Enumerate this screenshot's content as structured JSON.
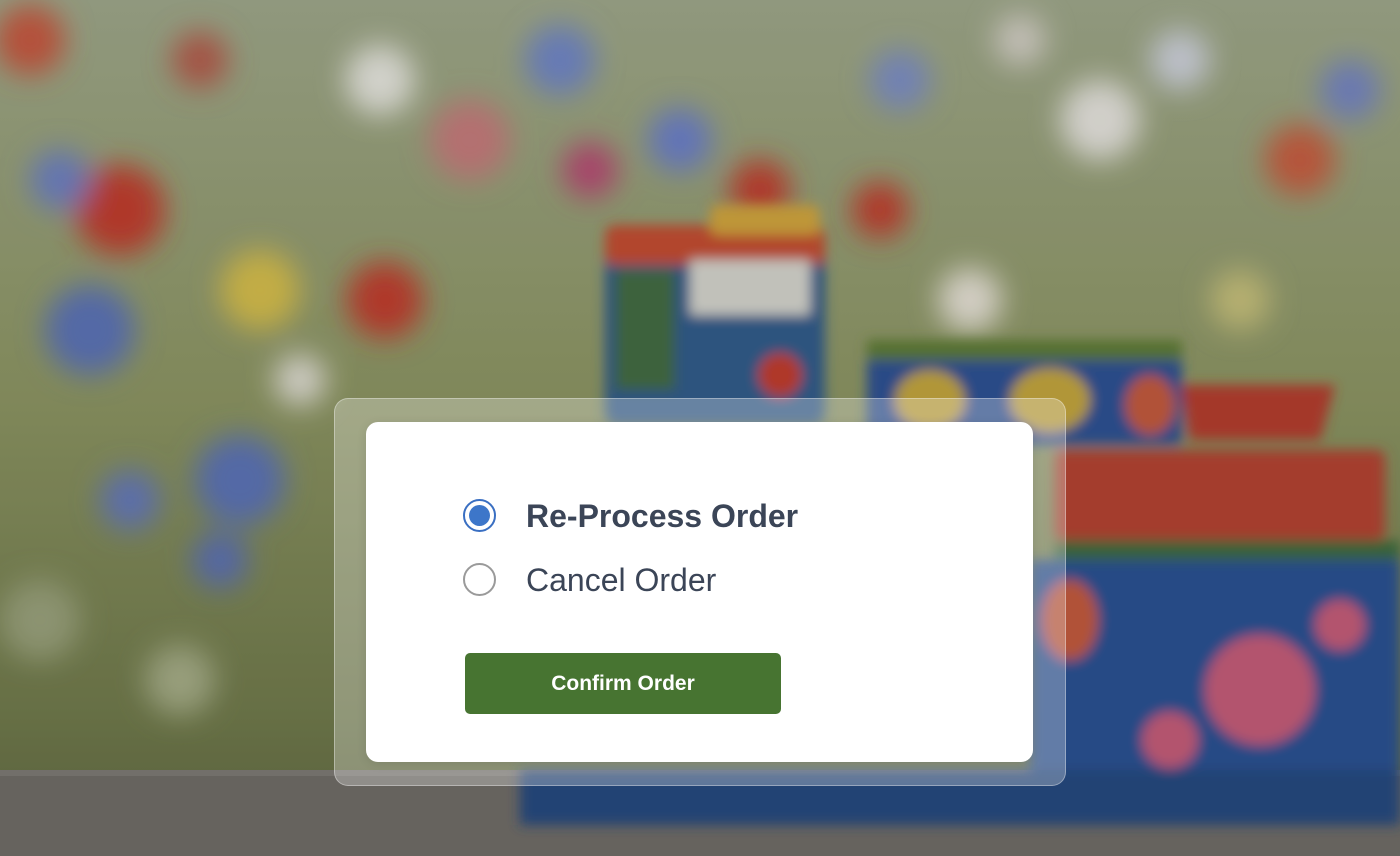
{
  "dialog": {
    "options": [
      {
        "label": "Re-Process Order",
        "selected": true
      },
      {
        "label": "Cancel Order",
        "selected": false
      }
    ],
    "confirm_label": "Confirm Order"
  },
  "background": {
    "description_icon": "flower-field-photo",
    "colors": {
      "field_green": "#7f8a52",
      "flower_red": "#c23a2c",
      "flower_blue": "#5a72b8",
      "flower_yellow": "#d8c04a",
      "table_gray": "#6f6b66"
    }
  },
  "colors": {
    "radio_accent": "#3d76c9",
    "button": "#477431",
    "text": "#3b4557"
  }
}
